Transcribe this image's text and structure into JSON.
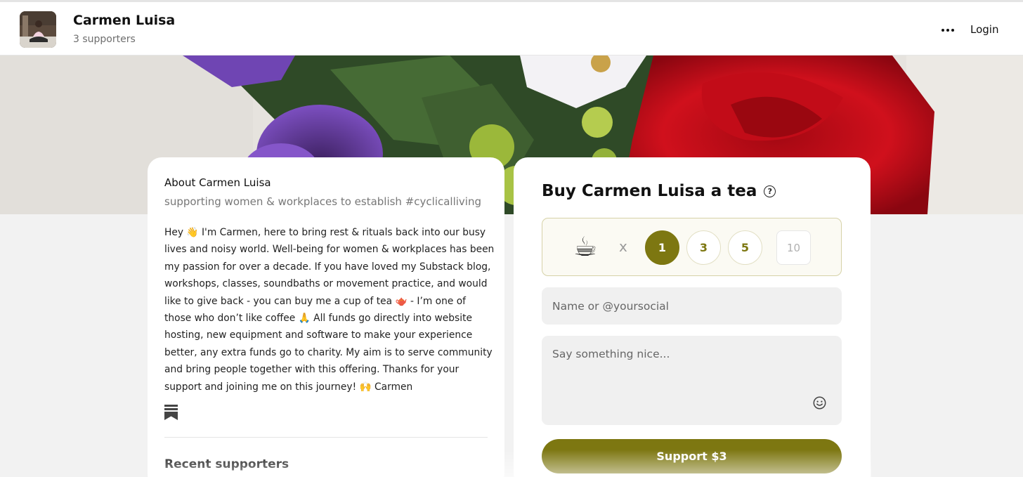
{
  "header": {
    "creator_name": "Carmen Luisa",
    "supporters_count": "3 supporters",
    "more_icon": "more-horizontal-icon",
    "login_label": "Login"
  },
  "about": {
    "title": "About Carmen Luisa",
    "tagline": "supporting women & workplaces to establish #cyclicalliving",
    "body": "Hey 👋 I'm Carmen, here to bring rest & rituals back into our busy lives and noisy world. Well-being for women & workplaces has been my passion for over a decade. If you have loved my Substack blog, workshops, classes, soundbaths or movement practice, and would like to give back - you can buy me a cup of tea 🫖 - I’m one of those who don’t like coffee 🙏 All funds go directly into website hosting, new equipment and software to make your  experience better, any extra funds go to charity. My aim is to serve community and bring people together with this offering. Thanks for your support and joining me on this journey! 🙌 Carmen",
    "link_icon": "substack-icon",
    "recent_supporters_title": "Recent supporters"
  },
  "buy": {
    "title": "Buy Carmen Luisa a tea",
    "help_icon": "question-circle-icon",
    "item_icon": "tea-cup-icon",
    "multiplier": "x",
    "quantities": [
      "1",
      "3",
      "5"
    ],
    "selected_quantity": "1",
    "custom_quantity_placeholder": "10",
    "name_placeholder": "Name or @yoursocial",
    "message_placeholder": "Say something nice...",
    "emoji_icon": "smiley-icon",
    "support_label": "Support $3"
  },
  "colors": {
    "accent": "#7d7711",
    "page_background": "#f2f2f2"
  }
}
